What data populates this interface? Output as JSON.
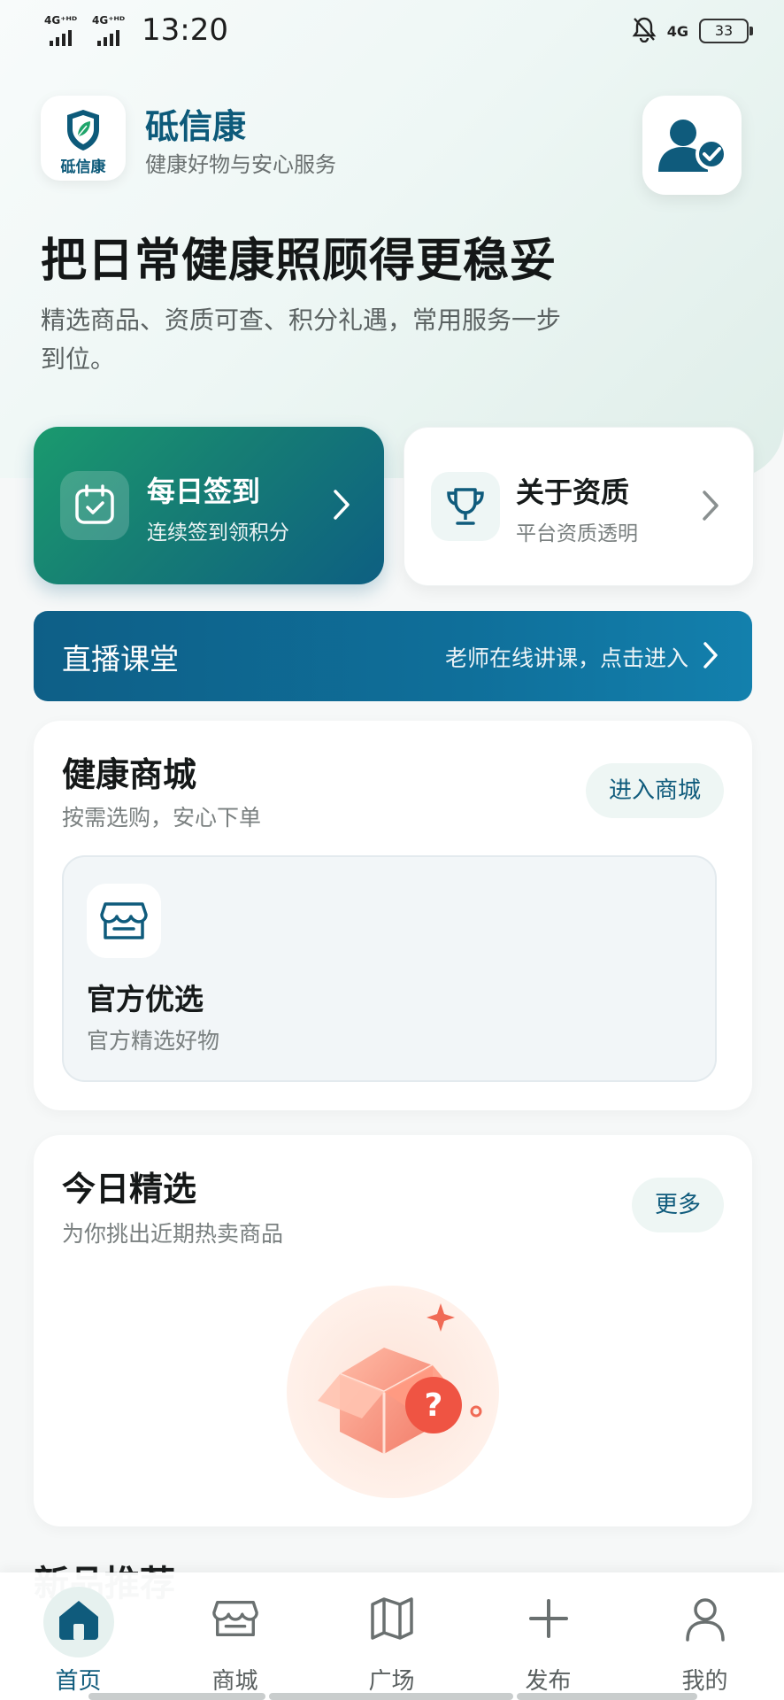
{
  "status_bar": {
    "signal_1": "4G⁺ᴴᴰ",
    "signal_2": "4G⁺ᴴᴰ",
    "time": "13:20",
    "network": "4G",
    "battery": "33"
  },
  "header": {
    "logo_text": "砥信康",
    "brand_name": "砥信康",
    "brand_sub": "健康好物与安心服务"
  },
  "hero": {
    "title": "把日常健康照顾得更稳妥",
    "desc": "精选商品、资质可查、积分礼遇，常用服务一步到位。"
  },
  "quick": {
    "sign": {
      "title": "每日签到",
      "sub": "连续签到领积分"
    },
    "qual": {
      "title": "关于资质",
      "sub": "平台资质透明"
    }
  },
  "live": {
    "title": "直播课堂",
    "sub": "老师在线讲课，点击进入"
  },
  "mall": {
    "title": "健康商城",
    "sub": "按需选购，安心下单",
    "enter": "进入商城",
    "card_title": "官方优选",
    "card_sub": "官方精选好物"
  },
  "today": {
    "title": "今日精选",
    "sub": "为你挑出近期热卖商品",
    "more": "更多"
  },
  "new_section": {
    "title": "新品推荐"
  },
  "tabs": [
    {
      "label": "首页",
      "icon": "home-icon"
    },
    {
      "label": "商城",
      "icon": "store-icon"
    },
    {
      "label": "广场",
      "icon": "map-icon"
    },
    {
      "label": "发布",
      "icon": "plus-icon"
    },
    {
      "label": "我的",
      "icon": "user-icon"
    }
  ],
  "colors": {
    "brand": "#0d5a7a",
    "green": "#1a9a6e",
    "live_blue": "#0e5f87",
    "pill_bg": "#eef6f4"
  }
}
